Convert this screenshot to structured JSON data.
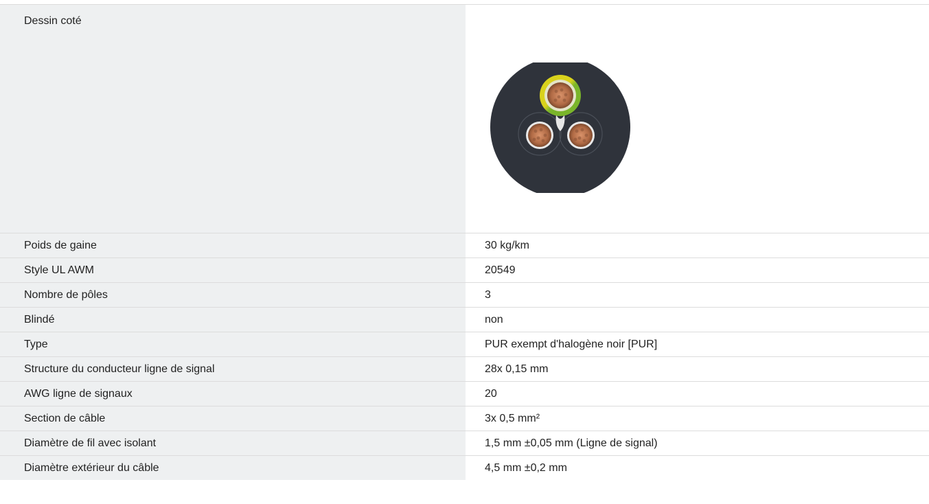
{
  "drawing_row": {
    "label": "Dessin coté",
    "image_icon": "cable-cross-section-drawing"
  },
  "rows": [
    {
      "label": "Poids de gaine",
      "value": "30 kg/km"
    },
    {
      "label": "Style UL AWM",
      "value": "20549"
    },
    {
      "label": "Nombre de pôles",
      "value": "3"
    },
    {
      "label": "Blindé",
      "value": "non"
    },
    {
      "label": "Type",
      "value": "PUR exempt d'halogène noir [PUR]"
    },
    {
      "label": "Structure du conducteur ligne de signal",
      "value": "28x 0,15 mm"
    },
    {
      "label": "AWG ligne de signaux",
      "value": "20"
    },
    {
      "label": "Section de câble",
      "value": "3x 0,5 mm²"
    },
    {
      "label": "Diamètre de fil avec isolant",
      "value": "1,5 mm ±0,05 mm (Ligne de signal)"
    },
    {
      "label": "Diamètre extérieur du câble",
      "value": "4,5 mm ±0,2 mm"
    }
  ],
  "colors": {
    "label_bg": "#eef0f1",
    "border": "#dcdcdc",
    "jacket": "#2f333b",
    "earth_green": "#7ab52a",
    "earth_yellow": "#d9d21c",
    "copper": "#b06a45"
  }
}
